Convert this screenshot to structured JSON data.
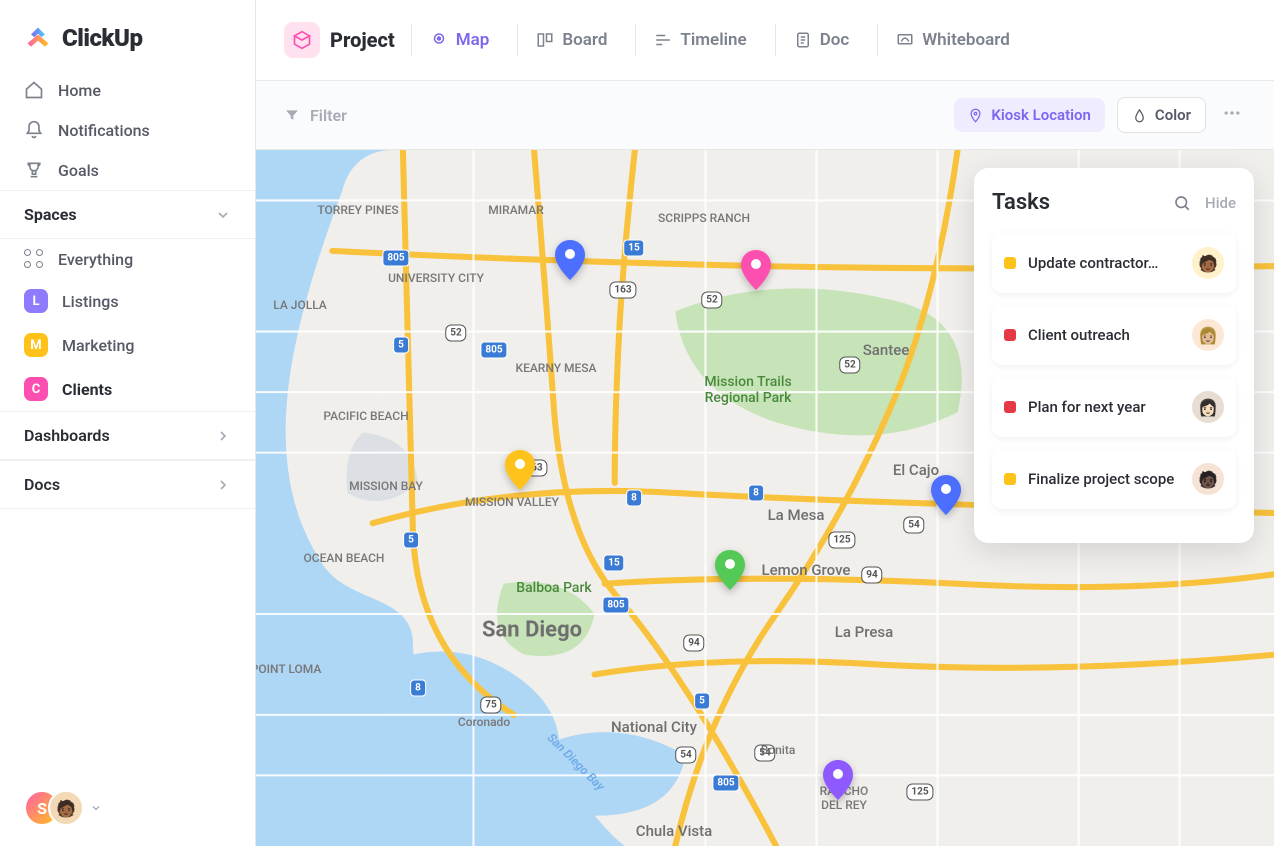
{
  "brand": "ClickUp",
  "nav": {
    "home": "Home",
    "notifications": "Notifications",
    "goals": "Goals"
  },
  "spaces": {
    "header": "Spaces",
    "everything": "Everything",
    "items": [
      {
        "letter": "L",
        "label": "Listings",
        "color": "#8e7bff"
      },
      {
        "letter": "M",
        "label": "Marketing",
        "color": "#ffc21a"
      },
      {
        "letter": "C",
        "label": "Clients",
        "color": "#fd4fb0",
        "active": true
      }
    ]
  },
  "sections": {
    "dashboards": "Dashboards",
    "docs": "Docs"
  },
  "footer": {
    "initial": "S"
  },
  "header": {
    "project": "Project",
    "tabs": {
      "map": "Map",
      "board": "Board",
      "timeline": "Timeline",
      "doc": "Doc",
      "whiteboard": "Whiteboard"
    }
  },
  "toolbar": {
    "filter": "Filter",
    "kiosk": "Kiosk Location",
    "color": "Color"
  },
  "map": {
    "labels": {
      "sandiego": "San Diego",
      "lamesa": "La Mesa",
      "santee": "Santee",
      "elcajon": "El Cajo",
      "lapresa": "La Presa",
      "bonita": "Bonita",
      "ranchodelrey": "RANCHO\nDEL REY",
      "chulavista": "Chula Vista",
      "nationalcity": "National City",
      "coronado": "Coronado",
      "pointloma": "POINT LOMA",
      "oceanbeach": "OCEAN BEACH",
      "missionbay": "MISSION BAY",
      "pacificbeach": "PACIFIC BEACH",
      "lajolla": "LA JOLLA",
      "universitycity": "UNIVERSITY CITY",
      "torreypines": "TORREY PINES",
      "miramar": "MIRAMAR",
      "scrippsranch": "SCRIPPS RANCH",
      "kearnymesa": "KEARNY MESA",
      "missionvalley": "MISSION VALLEY",
      "balboapark": "Balboa Park",
      "missiontrails": "Mission Trails\nRegional Park",
      "lemongrove": "Lemon Grove",
      "sandiegobay": "San Diego Bay"
    }
  },
  "tasks": {
    "title": "Tasks",
    "hide": "Hide",
    "items": [
      {
        "status": "#ffc21a",
        "title": "Update contractor…",
        "avatar_bg": "#fff1c9",
        "avatar_emoji": "🧑🏾"
      },
      {
        "status": "#e63946",
        "title": "Client outreach",
        "avatar_bg": "#fde8d6",
        "avatar_emoji": "👩🏼"
      },
      {
        "status": "#e63946",
        "title": "Plan for next year",
        "avatar_bg": "#e7ddd3",
        "avatar_emoji": "👩🏻"
      },
      {
        "status": "#ffc21a",
        "title": "Finalize project scope",
        "avatar_bg": "#f6e3d6",
        "avatar_emoji": "🧑🏿"
      }
    ]
  }
}
